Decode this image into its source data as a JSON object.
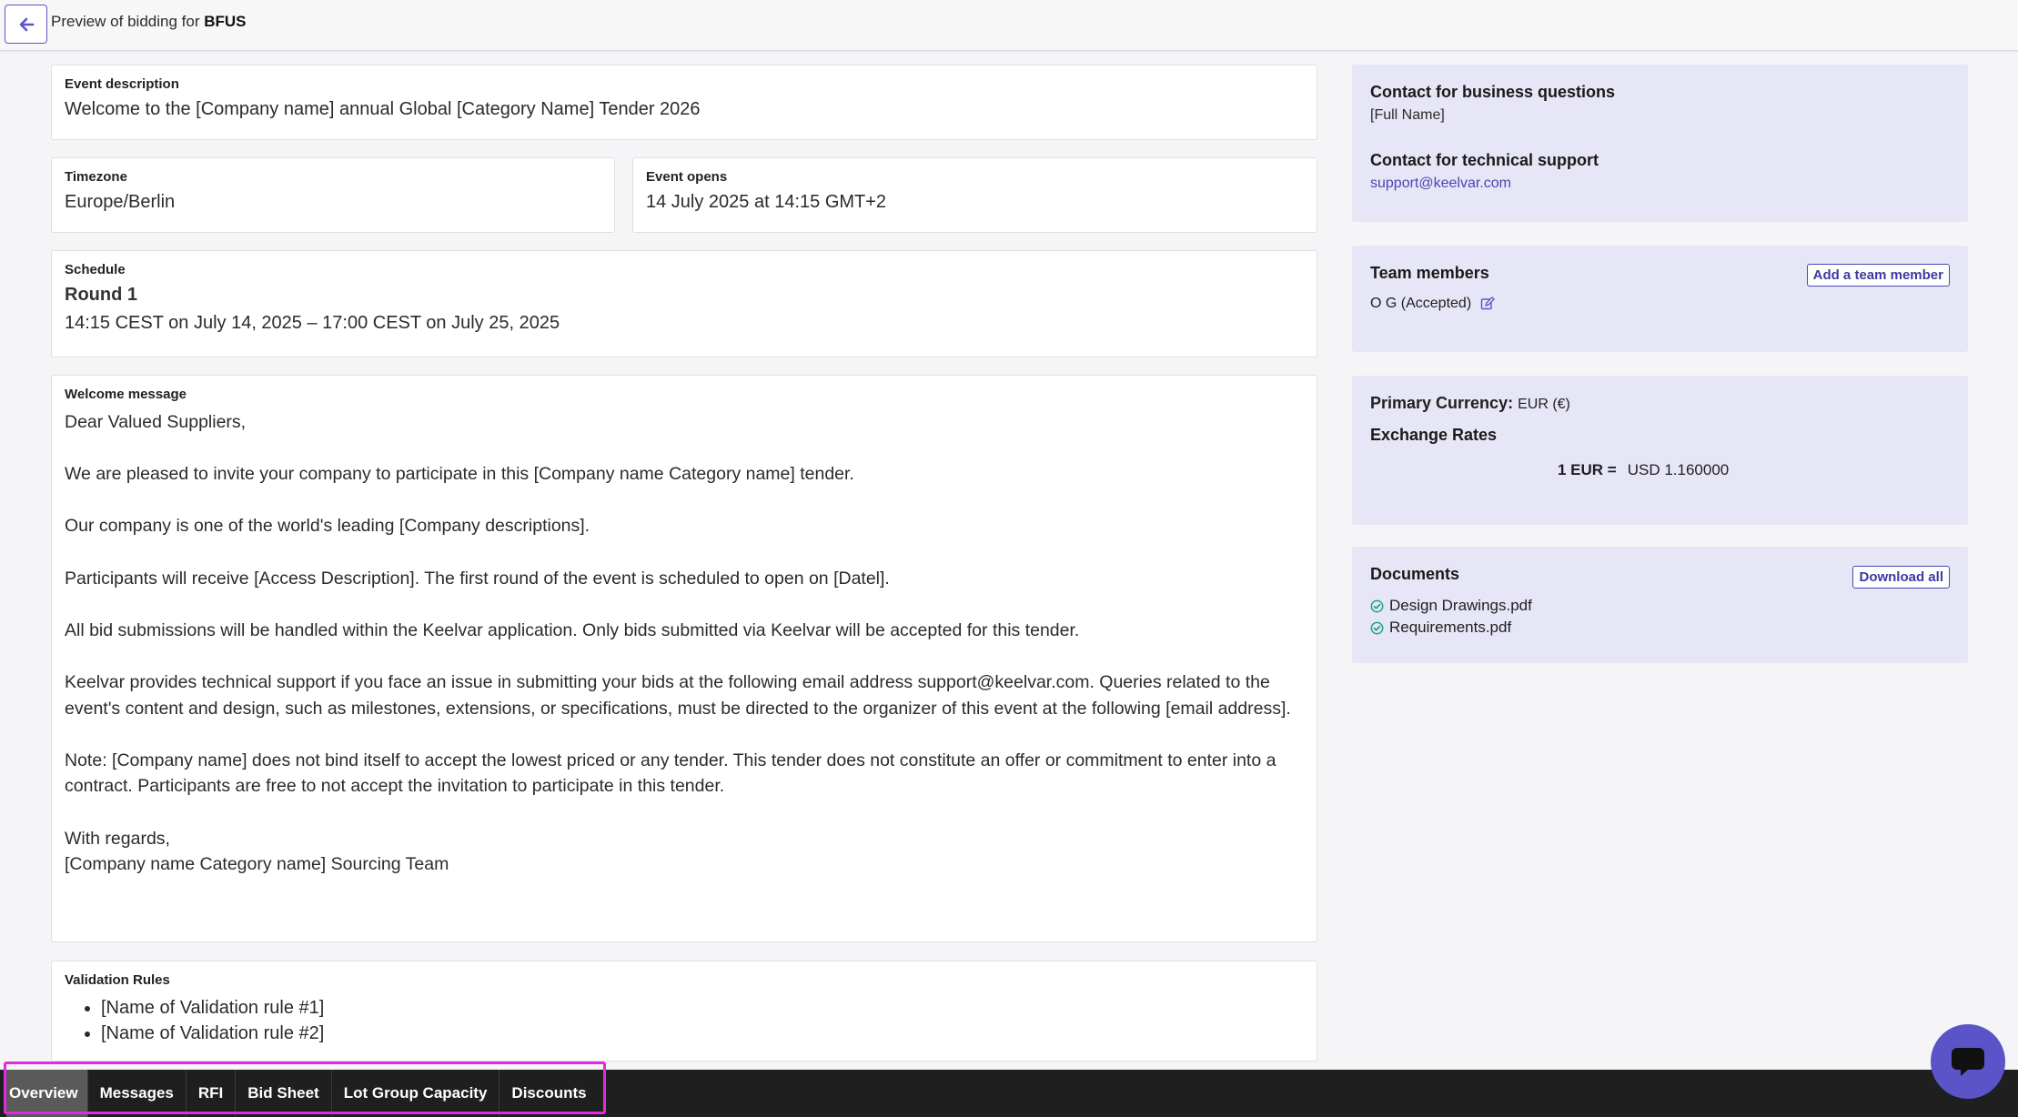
{
  "header": {
    "title_prefix": "Preview of bidding for",
    "event_code": "BFUS"
  },
  "event_description": {
    "label": "Event description",
    "value": "Welcome to the [Company name] annual Global [Category Name] Tender 2026"
  },
  "timezone": {
    "label": "Timezone",
    "value": "Europe/Berlin"
  },
  "event_opens": {
    "label": "Event opens",
    "value": "14 July 2025 at 14:15 GMT+2"
  },
  "schedule": {
    "label": "Schedule",
    "round": "Round 1",
    "range": "14:15 CEST on July 14, 2025 – 17:00 CEST on July 25, 2025"
  },
  "welcome": {
    "label": "Welcome message",
    "paragraphs": [
      "Dear Valued Suppliers,",
      "We are pleased to invite your company to participate in this [Company name Category name] tender.",
      "Our company is one of the world's leading [Company descriptions].",
      "Participants will receive [Access Description]. The first round of the event is scheduled to open on [Datel].",
      "All bid submissions will be handled within the Keelvar application. Only bids submitted via Keelvar will be accepted for this tender.",
      "Keelvar provides technical support if you face an issue in submitting your bids at the following email address support@keelvar.com. Queries related to the event's content and design, such as milestones, extensions, or specifications, must be directed to the organizer of this event at the following [email address].",
      "Note: [Company name] does not bind itself to accept the lowest priced or any tender. This tender does not constitute an offer or commitment to enter into a contract. Participants are free to not accept the invitation to participate in this tender.",
      "With regards,",
      "[Company name Category name] Sourcing Team"
    ]
  },
  "validation": {
    "label": "Validation Rules",
    "rules": [
      "[Name of Validation rule #1]",
      "[Name of Validation rule #2]"
    ]
  },
  "contact": {
    "business_label": "Contact for business questions",
    "business_name": "[Full Name]",
    "tech_label": "Contact for technical support",
    "tech_email": "support@keelvar.com"
  },
  "team": {
    "title": "Team members",
    "add_button": "Add a team member",
    "members": [
      {
        "name": "O G (Accepted)"
      }
    ]
  },
  "currency": {
    "primary_label": "Primary Currency:",
    "primary_value": "EUR (€)",
    "rates_label": "Exchange Rates",
    "rate_base": "1 EUR =",
    "rate_value": "USD 1.160000"
  },
  "documents": {
    "title": "Documents",
    "download_button": "Download all",
    "files": [
      "Design Drawings.pdf",
      "Requirements.pdf"
    ]
  },
  "tabs": [
    {
      "label": "Overview",
      "active": true
    },
    {
      "label": "Messages",
      "active": false
    },
    {
      "label": "RFI",
      "active": false
    },
    {
      "label": "Bid Sheet",
      "active": false
    },
    {
      "label": "Lot Group Capacity",
      "active": false
    },
    {
      "label": "Discounts",
      "active": false
    }
  ],
  "colors": {
    "accent": "#5b54c9",
    "panel_bg": "#e6e6f7",
    "tabbar_bg": "#1f1f1f",
    "check_green": "#1aa67a",
    "highlight": "#e02be0"
  },
  "icons": {
    "back": "arrow-left-icon",
    "edit": "edit-icon",
    "check": "check-circle-icon",
    "chat": "chat-bubble-icon"
  }
}
